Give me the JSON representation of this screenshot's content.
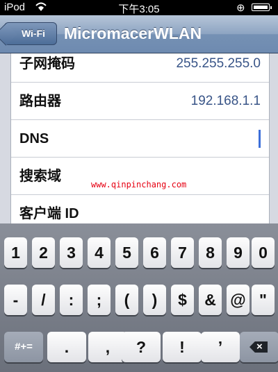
{
  "status": {
    "carrier": "iPod",
    "time": "下午3:05"
  },
  "nav": {
    "back_label": "Wi-Fi",
    "title": "MicromacerWLAN"
  },
  "rows": [
    {
      "label": "子网掩码",
      "value": "255.255.255.0"
    },
    {
      "label": "路由器",
      "value": "192.168.1.1"
    },
    {
      "label": "DNS",
      "value": ""
    },
    {
      "label": "搜索域",
      "value": ""
    },
    {
      "label": "客户端 ID",
      "value": ""
    }
  ],
  "watermark": "www.qinpinchang.com",
  "keyboard": {
    "row1": [
      "1",
      "2",
      "3",
      "4",
      "5",
      "6",
      "7",
      "8",
      "9",
      "0"
    ],
    "row2": [
      "-",
      "/",
      ":",
      ";",
      "(",
      ")",
      "$",
      "&",
      "@",
      "\""
    ],
    "row3_left": "#+=",
    "row3": [
      ".",
      ",",
      "?",
      "!",
      "’"
    ]
  }
}
